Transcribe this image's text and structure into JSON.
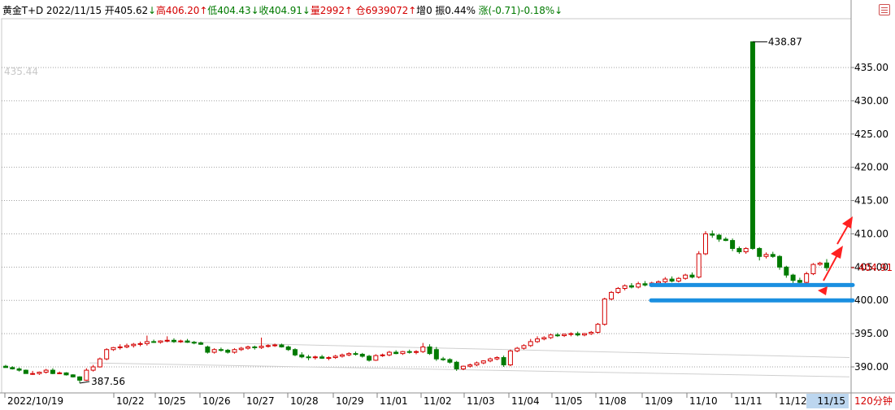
{
  "header": {
    "symbol": "黄金T+D",
    "date": "2022/11/15",
    "open_label": "开",
    "open": "405.62",
    "open_arrow": "↓",
    "high_label": "高",
    "high": "406.20",
    "high_arrow": "↑",
    "low_label": "低",
    "low": "404.43",
    "low_arrow": "↓",
    "close_label": "收",
    "close": "404.91",
    "close_arrow": "↓",
    "volume_label": "量",
    "volume": "2992",
    "volume_arrow": "↑",
    "position_label": "仓",
    "position": "6939072",
    "position_arrow": "↑",
    "increase_label": "增",
    "increase": "0",
    "amplitude_label": "振",
    "amplitude": "0.44%",
    "change_label": "涨",
    "change": "(-0.71)-0.18%",
    "change_arrow": "↓"
  },
  "period_label": "120分钟",
  "last_price": "404.91",
  "faded_high_label": "435.44",
  "high_annotation": "438.87",
  "low_annotation": "387.56",
  "selected_date": "11/15",
  "colors": {
    "up": "#d40000",
    "down": "#007a00",
    "support_line": "#1a8fe0",
    "arrow": "#ff2020",
    "grid": "#a0a0a0"
  },
  "chart_data": {
    "type": "candlestick",
    "y_axis": {
      "position": "right",
      "ylim": [
        388,
        441
      ],
      "ticks": [
        "435.00",
        "430.00",
        "425.00",
        "420.00",
        "415.00",
        "410.00",
        "405.00",
        "400.00",
        "395.00",
        "390.00"
      ]
    },
    "x_axis_labels": [
      "2022/10/19",
      "10/22",
      "10/25",
      "10/26",
      "10/27",
      "10/28",
      "10/29",
      "11/01",
      "11/02",
      "11/03",
      "11/04",
      "11/05",
      "11/08",
      "11/09",
      "11/10",
      "11/11",
      "11/12",
      "11/15"
    ],
    "candles": [
      {
        "o": 390.1,
        "h": 390.3,
        "l": 389.9,
        "c": 389.9
      },
      {
        "o": 389.9,
        "h": 390.1,
        "l": 389.6,
        "c": 389.7
      },
      {
        "o": 389.7,
        "h": 389.9,
        "l": 389.3,
        "c": 389.5
      },
      {
        "o": 389.5,
        "h": 389.6,
        "l": 389.0,
        "c": 389.0
      },
      {
        "o": 389.0,
        "h": 389.4,
        "l": 388.8,
        "c": 389.0
      },
      {
        "o": 389.0,
        "h": 389.3,
        "l": 388.8,
        "c": 389.2
      },
      {
        "o": 389.2,
        "h": 389.7,
        "l": 389.0,
        "c": 389.5
      },
      {
        "o": 389.5,
        "h": 389.8,
        "l": 388.9,
        "c": 389.0
      },
      {
        "o": 389.0,
        "h": 389.3,
        "l": 388.9,
        "c": 389.1
      },
      {
        "o": 389.1,
        "h": 389.2,
        "l": 388.7,
        "c": 388.8
      },
      {
        "o": 388.8,
        "h": 388.9,
        "l": 388.4,
        "c": 388.5
      },
      {
        "o": 388.5,
        "h": 388.6,
        "l": 387.56,
        "c": 388.0
      },
      {
        "o": 388.0,
        "h": 389.8,
        "l": 387.9,
        "c": 389.5
      },
      {
        "o": 389.5,
        "h": 390.3,
        "l": 389.3,
        "c": 390.0
      },
      {
        "o": 390.0,
        "h": 391.4,
        "l": 389.9,
        "c": 391.2
      },
      {
        "o": 391.2,
        "h": 392.8,
        "l": 391.0,
        "c": 392.6
      },
      {
        "o": 392.6,
        "h": 393.0,
        "l": 392.4,
        "c": 392.9
      },
      {
        "o": 392.9,
        "h": 393.4,
        "l": 392.6,
        "c": 393.0
      },
      {
        "o": 393.0,
        "h": 393.5,
        "l": 392.8,
        "c": 393.2
      },
      {
        "o": 393.2,
        "h": 393.6,
        "l": 392.9,
        "c": 393.4
      },
      {
        "o": 393.4,
        "h": 393.8,
        "l": 393.1,
        "c": 393.5
      },
      {
        "o": 393.5,
        "h": 394.7,
        "l": 393.2,
        "c": 393.8
      },
      {
        "o": 393.8,
        "h": 394.1,
        "l": 393.6,
        "c": 393.7
      },
      {
        "o": 393.7,
        "h": 394.0,
        "l": 393.5,
        "c": 393.9
      },
      {
        "o": 393.9,
        "h": 394.6,
        "l": 393.7,
        "c": 394.0
      },
      {
        "o": 394.0,
        "h": 394.3,
        "l": 393.6,
        "c": 393.8
      },
      {
        "o": 393.8,
        "h": 394.1,
        "l": 393.6,
        "c": 393.9
      },
      {
        "o": 393.9,
        "h": 394.2,
        "l": 393.6,
        "c": 393.7
      },
      {
        "o": 393.7,
        "h": 393.9,
        "l": 393.4,
        "c": 393.6
      },
      {
        "o": 393.6,
        "h": 393.8,
        "l": 393.3,
        "c": 393.4
      },
      {
        "o": 393.0,
        "h": 393.2,
        "l": 392.0,
        "c": 392.2
      },
      {
        "o": 392.2,
        "h": 392.8,
        "l": 392.0,
        "c": 392.6
      },
      {
        "o": 392.6,
        "h": 392.9,
        "l": 392.3,
        "c": 392.5
      },
      {
        "o": 392.5,
        "h": 392.7,
        "l": 392.0,
        "c": 392.2
      },
      {
        "o": 392.2,
        "h": 392.8,
        "l": 392.0,
        "c": 392.6
      },
      {
        "o": 392.6,
        "h": 393.0,
        "l": 392.4,
        "c": 392.8
      },
      {
        "o": 392.8,
        "h": 393.2,
        "l": 392.6,
        "c": 393.0
      },
      {
        "o": 393.0,
        "h": 393.2,
        "l": 392.6,
        "c": 392.9
      },
      {
        "o": 392.9,
        "h": 394.4,
        "l": 392.7,
        "c": 393.1
      },
      {
        "o": 393.1,
        "h": 393.4,
        "l": 392.9,
        "c": 393.2
      },
      {
        "o": 393.2,
        "h": 393.5,
        "l": 393.0,
        "c": 393.3
      },
      {
        "o": 393.3,
        "h": 393.5,
        "l": 392.9,
        "c": 393.0
      },
      {
        "o": 393.0,
        "h": 393.2,
        "l": 392.4,
        "c": 392.6
      },
      {
        "o": 392.6,
        "h": 392.8,
        "l": 391.6,
        "c": 391.8
      },
      {
        "o": 391.8,
        "h": 392.2,
        "l": 391.3,
        "c": 391.5
      },
      {
        "o": 391.5,
        "h": 391.8,
        "l": 391.0,
        "c": 391.4
      },
      {
        "o": 391.4,
        "h": 391.7,
        "l": 391.1,
        "c": 391.5
      },
      {
        "o": 391.5,
        "h": 391.8,
        "l": 391.2,
        "c": 391.3
      },
      {
        "o": 391.3,
        "h": 391.6,
        "l": 391.0,
        "c": 391.4
      },
      {
        "o": 391.4,
        "h": 391.8,
        "l": 391.2,
        "c": 391.6
      },
      {
        "o": 391.6,
        "h": 392.0,
        "l": 391.4,
        "c": 391.8
      },
      {
        "o": 391.8,
        "h": 392.2,
        "l": 391.6,
        "c": 392.0
      },
      {
        "o": 392.0,
        "h": 392.3,
        "l": 391.7,
        "c": 391.9
      },
      {
        "o": 391.9,
        "h": 392.1,
        "l": 391.4,
        "c": 391.6
      },
      {
        "o": 391.6,
        "h": 391.8,
        "l": 390.8,
        "c": 391.0
      },
      {
        "o": 391.0,
        "h": 391.9,
        "l": 390.9,
        "c": 391.7
      },
      {
        "o": 391.7,
        "h": 392.0,
        "l": 391.5,
        "c": 391.8
      },
      {
        "o": 391.8,
        "h": 392.4,
        "l": 391.6,
        "c": 392.2
      },
      {
        "o": 392.2,
        "h": 392.5,
        "l": 391.9,
        "c": 392.0
      },
      {
        "o": 392.0,
        "h": 392.4,
        "l": 391.8,
        "c": 392.3
      },
      {
        "o": 392.3,
        "h": 392.6,
        "l": 392.0,
        "c": 392.2
      },
      {
        "o": 392.2,
        "h": 392.5,
        "l": 391.9,
        "c": 392.3
      },
      {
        "o": 392.3,
        "h": 393.6,
        "l": 392.1,
        "c": 393.0
      },
      {
        "o": 393.0,
        "h": 393.4,
        "l": 391.8,
        "c": 392.0
      },
      {
        "o": 392.6,
        "h": 393.0,
        "l": 390.9,
        "c": 391.2
      },
      {
        "o": 391.2,
        "h": 391.5,
        "l": 390.9,
        "c": 391.1
      },
      {
        "o": 391.1,
        "h": 391.3,
        "l": 390.5,
        "c": 390.7
      },
      {
        "o": 390.7,
        "h": 390.9,
        "l": 389.4,
        "c": 389.7
      },
      {
        "o": 389.7,
        "h": 390.2,
        "l": 389.5,
        "c": 390.1
      },
      {
        "o": 390.1,
        "h": 390.5,
        "l": 389.9,
        "c": 390.3
      },
      {
        "o": 390.3,
        "h": 390.8,
        "l": 390.1,
        "c": 390.6
      },
      {
        "o": 390.6,
        "h": 391.0,
        "l": 390.4,
        "c": 390.9
      },
      {
        "o": 390.9,
        "h": 391.4,
        "l": 390.7,
        "c": 391.2
      },
      {
        "o": 391.2,
        "h": 391.6,
        "l": 391.0,
        "c": 391.4
      },
      {
        "o": 391.4,
        "h": 391.7,
        "l": 390.0,
        "c": 390.3
      },
      {
        "o": 390.3,
        "h": 392.6,
        "l": 390.1,
        "c": 392.4
      },
      {
        "o": 392.4,
        "h": 393.0,
        "l": 392.2,
        "c": 392.8
      },
      {
        "o": 392.8,
        "h": 393.4,
        "l": 392.6,
        "c": 393.2
      },
      {
        "o": 393.2,
        "h": 394.2,
        "l": 393.0,
        "c": 393.8
      },
      {
        "o": 393.8,
        "h": 394.6,
        "l": 393.6,
        "c": 394.2
      },
      {
        "o": 394.2,
        "h": 394.6,
        "l": 394.0,
        "c": 394.4
      },
      {
        "o": 394.4,
        "h": 395.0,
        "l": 394.2,
        "c": 394.8
      },
      {
        "o": 394.8,
        "h": 395.1,
        "l": 394.5,
        "c": 394.7
      },
      {
        "o": 394.7,
        "h": 395.0,
        "l": 394.5,
        "c": 394.9
      },
      {
        "o": 394.9,
        "h": 395.2,
        "l": 394.6,
        "c": 395.0
      },
      {
        "o": 395.0,
        "h": 395.3,
        "l": 394.6,
        "c": 394.8
      },
      {
        "o": 394.8,
        "h": 395.1,
        "l": 394.6,
        "c": 395.0
      },
      {
        "o": 395.0,
        "h": 395.4,
        "l": 394.8,
        "c": 395.2
      },
      {
        "o": 395.2,
        "h": 396.6,
        "l": 395.0,
        "c": 396.4
      },
      {
        "o": 396.4,
        "h": 400.4,
        "l": 396.2,
        "c": 400.2
      },
      {
        "o": 400.2,
        "h": 401.4,
        "l": 400.0,
        "c": 401.2
      },
      {
        "o": 401.2,
        "h": 402.0,
        "l": 401.0,
        "c": 401.8
      },
      {
        "o": 401.8,
        "h": 402.4,
        "l": 401.5,
        "c": 402.2
      },
      {
        "o": 402.2,
        "h": 402.6,
        "l": 401.8,
        "c": 402.0
      },
      {
        "o": 402.0,
        "h": 402.8,
        "l": 401.8,
        "c": 402.5
      },
      {
        "o": 402.5,
        "h": 402.9,
        "l": 402.1,
        "c": 402.3
      },
      {
        "o": 402.3,
        "h": 402.8,
        "l": 402.0,
        "c": 402.6
      },
      {
        "o": 402.6,
        "h": 403.0,
        "l": 402.3,
        "c": 402.8
      },
      {
        "o": 402.8,
        "h": 403.5,
        "l": 402.6,
        "c": 403.2
      },
      {
        "o": 403.2,
        "h": 403.6,
        "l": 402.7,
        "c": 402.9
      },
      {
        "o": 402.9,
        "h": 403.5,
        "l": 402.7,
        "c": 403.3
      },
      {
        "o": 403.3,
        "h": 404.0,
        "l": 403.1,
        "c": 403.8
      },
      {
        "o": 403.8,
        "h": 404.2,
        "l": 403.3,
        "c": 403.5
      },
      {
        "o": 403.5,
        "h": 407.4,
        "l": 403.3,
        "c": 407.0
      },
      {
        "o": 407.0,
        "h": 410.4,
        "l": 406.8,
        "c": 410.0
      },
      {
        "o": 410.0,
        "h": 410.5,
        "l": 409.4,
        "c": 409.8
      },
      {
        "o": 409.8,
        "h": 410.0,
        "l": 408.8,
        "c": 409.2
      },
      {
        "o": 409.2,
        "h": 409.5,
        "l": 408.9,
        "c": 409.0
      },
      {
        "o": 409.0,
        "h": 409.3,
        "l": 407.4,
        "c": 407.8
      },
      {
        "o": 407.8,
        "h": 408.1,
        "l": 407.0,
        "c": 407.3
      },
      {
        "o": 407.3,
        "h": 408.0,
        "l": 407.0,
        "c": 407.8
      },
      {
        "o": 438.87,
        "h": 438.87,
        "l": 407.6,
        "c": 407.8
      },
      {
        "o": 407.8,
        "h": 408.0,
        "l": 406.0,
        "c": 406.6
      },
      {
        "o": 406.6,
        "h": 407.2,
        "l": 406.3,
        "c": 406.9
      },
      {
        "o": 406.9,
        "h": 407.3,
        "l": 406.4,
        "c": 406.6
      },
      {
        "o": 406.6,
        "h": 406.8,
        "l": 404.6,
        "c": 405.0
      },
      {
        "o": 405.0,
        "h": 405.2,
        "l": 403.4,
        "c": 403.8
      },
      {
        "o": 403.8,
        "h": 404.0,
        "l": 402.6,
        "c": 403.0
      },
      {
        "o": 403.0,
        "h": 403.4,
        "l": 402.4,
        "c": 402.7
      },
      {
        "o": 402.7,
        "h": 404.3,
        "l": 402.5,
        "c": 404.0
      },
      {
        "o": 404.0,
        "h": 405.6,
        "l": 403.8,
        "c": 405.4
      },
      {
        "o": 405.4,
        "h": 405.8,
        "l": 405.2,
        "c": 405.6
      },
      {
        "o": 405.62,
        "h": 406.2,
        "l": 404.43,
        "c": 404.91
      }
    ],
    "annotations": [
      {
        "type": "hline",
        "y": 402.3,
        "color": "#1a8fe0"
      },
      {
        "type": "hline",
        "y": 400.0,
        "color": "#1a8fe0"
      }
    ]
  }
}
